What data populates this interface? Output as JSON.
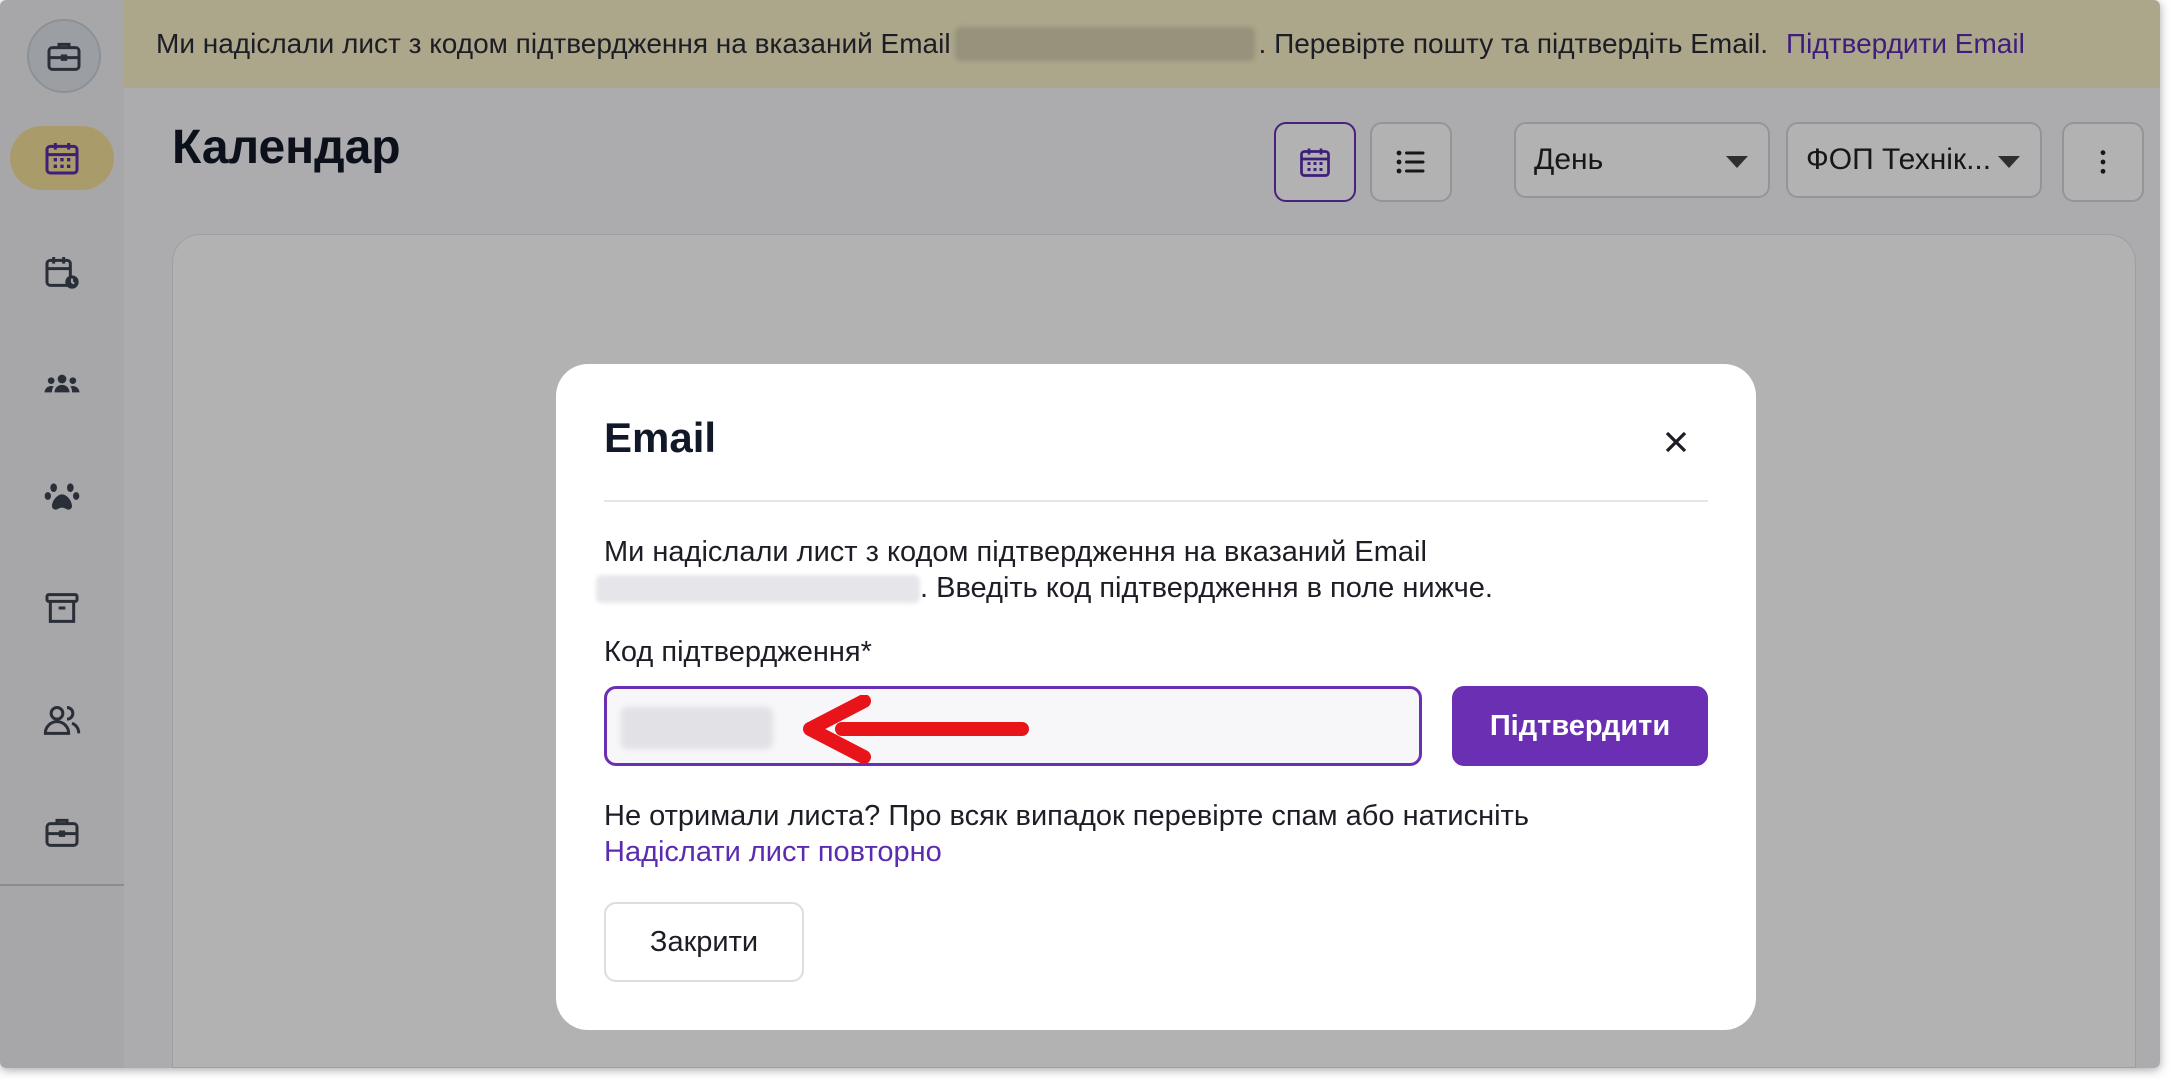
{
  "banner": {
    "text_before": "Ми надіслали лист з кодом підтвердження на вказаний Email",
    "text_after": ". Перевірте пошту та підтвердіть Email.",
    "link": "Підтвердити Email"
  },
  "header": {
    "title": "Календар",
    "view_select": "День",
    "org_select": "ФОП Технік..."
  },
  "modal": {
    "title": "Email",
    "description_line1": "Ми надіслали лист з кодом підтвердження на вказаний Email",
    "description_line2": ". Введіть код підтвердження в поле нижче.",
    "code_label": "Код підтвердження*",
    "confirm_button": "Підтвердити",
    "hint_text": "Не отримали листа? Про всяк випадок перевірте спам або натисніть",
    "resend_link": "Надіслати лист повторно",
    "close_button": "Закрити"
  },
  "colors": {
    "accent": "#6b2fb3",
    "banner_bg": "#f6efc7",
    "active_nav": "#f2df99",
    "arrow": "#e8141a"
  },
  "icons": {
    "sidebar": [
      "briefcase-icon",
      "calendar-icon",
      "calendar-clock-icon",
      "group-icon",
      "paw-icon",
      "archive-icon",
      "users-icon",
      "briefcase-icon"
    ]
  }
}
